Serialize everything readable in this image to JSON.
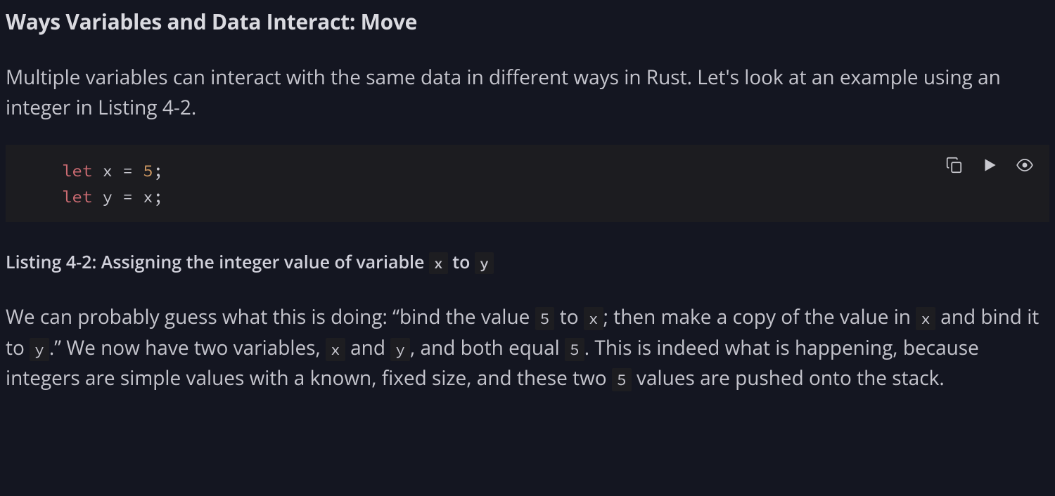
{
  "heading": "Ways Variables and Data Interact: Move",
  "intro": "Multiple variables can interact with the same data in different ways in Rust. Let's look at an example using an integer in Listing 4-2.",
  "code": {
    "line1": {
      "kw": "let",
      "id": "x",
      "eq": "=",
      "num": "5",
      "semi": ";"
    },
    "line2": {
      "kw": "let",
      "id": "y",
      "eq": "=",
      "rhs": "x",
      "semi": ";"
    }
  },
  "caption": {
    "pre": "Listing 4-2: Assigning the integer value of variable ",
    "code_x": "x",
    "mid": " to ",
    "code_y": "y"
  },
  "explain": {
    "t0": "We can probably guess what this is doing: “bind the value ",
    "c1": "5",
    "t1": " to ",
    "c2": "x",
    "t2": "; then make a copy of the value in ",
    "c3": "x",
    "t3": " and bind it to ",
    "c4": "y",
    "t4": ".” We now have two variables, ",
    "c5": "x",
    "t5": " and ",
    "c6": "y",
    "t6": ", and both equal ",
    "c7": "5",
    "t7": ". This is indeed what is happening, because integers are simple values with a known, fixed size, and these two ",
    "c8": "5",
    "t8": " values are pushed onto the stack."
  }
}
